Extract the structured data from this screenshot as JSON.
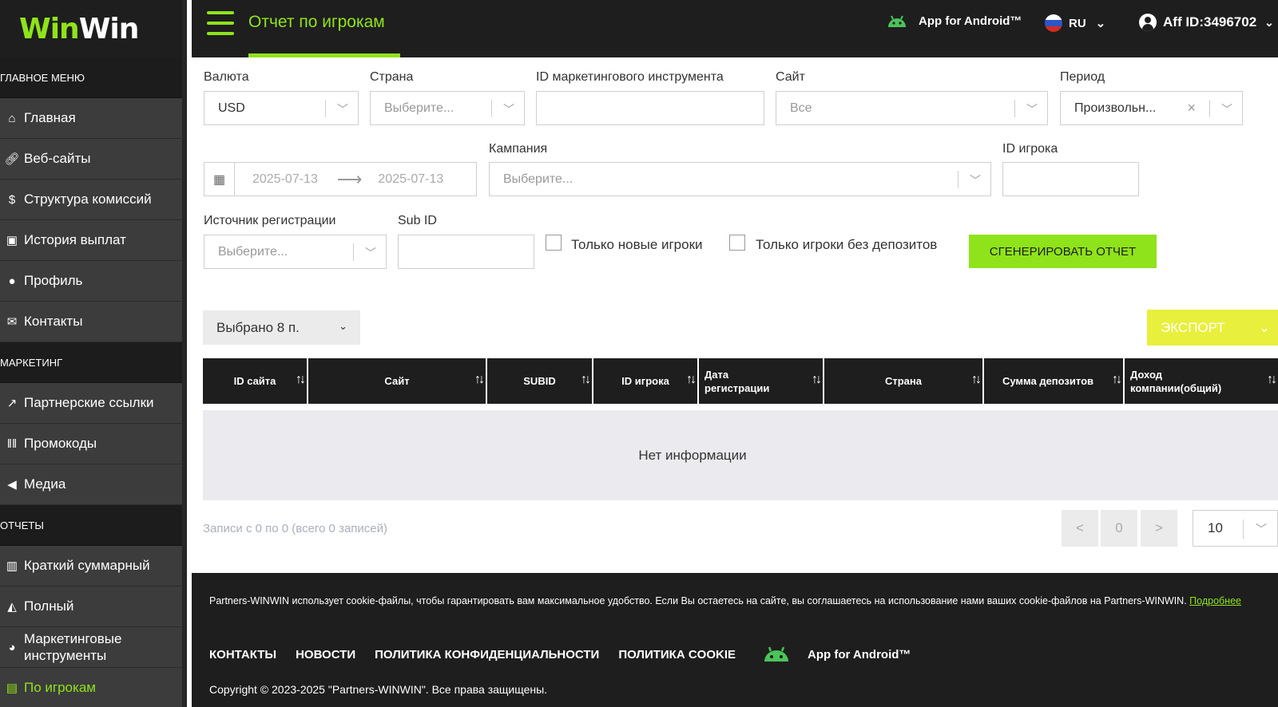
{
  "colors": {
    "accent": "#8fe31a",
    "dark": "#1e1e1e",
    "sidebar": "#3c3c3c",
    "export": "#e8ef3c"
  },
  "sidebar": {
    "logo_part1": "Win",
    "logo_part2": "Win",
    "sections": [
      {
        "title": "ГЛАВНОЕ МЕНЮ",
        "items": [
          {
            "label": "Главная",
            "icon": "home-icon"
          },
          {
            "label": "Веб-сайты",
            "icon": "link-icon"
          },
          {
            "label": "Структура комиссий",
            "icon": "dollar-icon"
          },
          {
            "label": "История выплат",
            "icon": "money-icon"
          },
          {
            "label": "Профиль",
            "icon": "user-icon"
          },
          {
            "label": "Контакты",
            "icon": "envelope-icon"
          }
        ]
      },
      {
        "title": "МАРКЕТИНГ",
        "items": [
          {
            "label": "Партнерские ссылки",
            "icon": "external-link-icon"
          },
          {
            "label": "Промокоды",
            "icon": "barcode-icon"
          },
          {
            "label": "Медиа",
            "icon": "bullhorn-icon"
          }
        ]
      },
      {
        "title": "ОТЧЕТЫ",
        "items": [
          {
            "label": "Краткий суммарный",
            "icon": "bar-chart-icon"
          },
          {
            "label": "Полный",
            "icon": "area-chart-icon"
          },
          {
            "label": "Маркетинговые инструменты",
            "icon": "palette-icon"
          },
          {
            "label": "По игрокам",
            "icon": "id-card-icon",
            "active": true
          }
        ]
      }
    ]
  },
  "header": {
    "title": "Отчет по игрокам",
    "android_label": "App for Android™",
    "language": "RU",
    "aff_id": "Aff ID:3496702"
  },
  "filters": {
    "currency": {
      "label": "Валюта",
      "value": "USD"
    },
    "country": {
      "label": "Страна",
      "placeholder": "Выберите..."
    },
    "marketing_id": {
      "label": "ID маркетингового инструмента",
      "value": ""
    },
    "site": {
      "label": "Сайт",
      "value": "Все"
    },
    "period": {
      "label": "Период",
      "value": "Произвольн..."
    },
    "date_from": "2025-07-13",
    "date_to": "2025-07-13",
    "campaign": {
      "label": "Кампания",
      "placeholder": "Выберите..."
    },
    "player_id": {
      "label": "ID игрока",
      "value": ""
    },
    "reg_source": {
      "label": "Источник регистрации",
      "placeholder": "Выберите..."
    },
    "sub_id": {
      "label": "Sub ID",
      "value": ""
    },
    "only_new": "Только новые игроки",
    "only_no_deposit": "Только игроки без депозитов",
    "generate": "СГЕНЕРИРОВАТЬ ОТЧЕТ"
  },
  "table": {
    "selected_columns": "Выбрано 8 п.",
    "export": "ЭКСПОРТ",
    "columns": [
      "ID сайта",
      "Сайт",
      "SUBID",
      "ID игрока",
      "Дата регистрации",
      "Страна",
      "Сумма депозитов",
      "Доход компании(общий)"
    ],
    "empty": "Нет информации",
    "records": "Записи с 0 по 0 (всего 0 записей)",
    "prev": "<",
    "page": "0",
    "next": ">",
    "per_page": "10"
  },
  "footer": {
    "cookie_text": "Partners-WINWIN использует cookie-файлы, чтобы гарантировать вам максимальное удобство. Если Вы остаетесь на сайте, вы соглашаетесь на использование нами ваших cookie-файлов на Partners-WINWIN.",
    "cookie_link": "Подробнее",
    "links": [
      "КОНТАКТЫ",
      "НОВОСТИ",
      "ПОЛИТИКА КОНФИДЕНЦИАЛЬНОСТИ",
      "ПОЛИТИКА COOKIE"
    ],
    "android_label": "App for Android™",
    "copyright": "Copyright © 2023-2025 \"Partners-WINWIN\". Все права защищены."
  }
}
